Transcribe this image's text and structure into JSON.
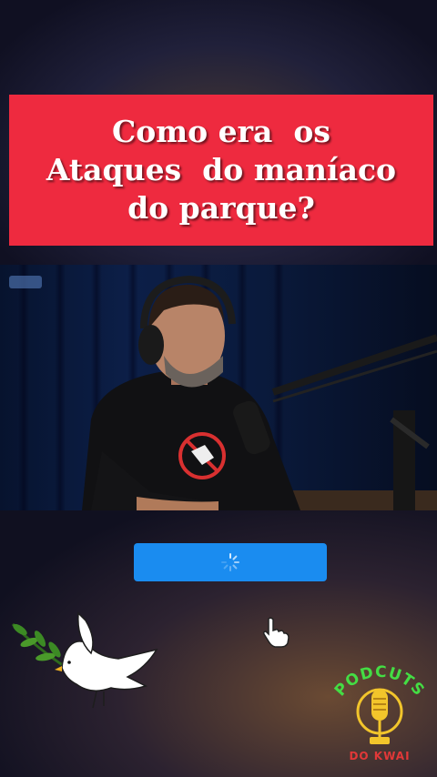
{
  "title": {
    "lines": [
      "Como era  os",
      "Ataques  do maníaco",
      "do parque?"
    ],
    "background_color": "#ee2a3f",
    "text_color": "#ffffff"
  },
  "video": {
    "state": "playing",
    "shirt_icon": "no-symbol-icon"
  },
  "load_button": {
    "color": "#1a8cf0",
    "icon": "loading-spinner-icon"
  },
  "cursor": {
    "icon": "hand-pointer-icon"
  },
  "decoration": {
    "icon": "dove-with-olive-branch-icon"
  },
  "logo": {
    "top_text": "PODCUTS",
    "bottom_text": "DO KWAI",
    "icon": "microphone-icon",
    "colors": {
      "top": "#44dd44",
      "bottom": "#e23838",
      "mic": "#f2c52b"
    }
  }
}
